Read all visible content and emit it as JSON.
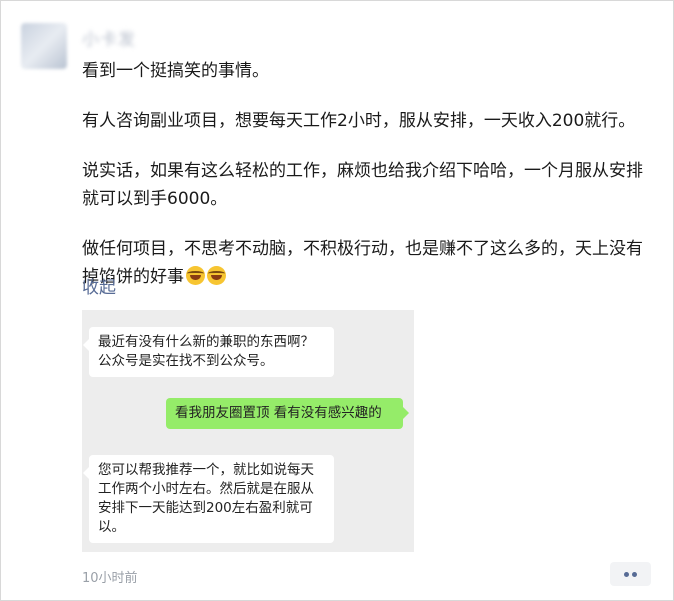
{
  "post": {
    "username": "小卡发",
    "paragraphs": [
      "看到一个挺搞笑的事情。",
      "有人咨询副业项目，想要每天工作2小时，服从安排，一天收入200就行。",
      "说实话，如果有这么轻松的工作，麻烦也给我介绍下哈哈，一个月服从安排就可以到手6000。",
      "做任何项目，不思考不动脑，不积极行动，也是赚不了这么多的，天上没有掉馅饼的好事"
    ],
    "emoji_icons": [
      "laughing-tears-icon",
      "laughing-tears-icon"
    ],
    "collapse_label": "收起",
    "timestamp": "10小时前"
  },
  "chat_screenshot": {
    "messages": [
      {
        "side": "left",
        "text": "最近有没有什么新的兼职的东西啊？公众号是实在找不到公众号。"
      },
      {
        "side": "right",
        "text": "看我朋友圈置顶 看有没有感兴趣的"
      },
      {
        "side": "left",
        "text": "您可以帮我推荐一个，就比如说每天工作两个小时左右。然后就是在服从安排下一天能达到200左右盈利就可以。"
      }
    ]
  },
  "colors": {
    "link": "#576b95",
    "self_bubble": "#95ec69",
    "other_bubble": "#ffffff",
    "chat_background": "#ededed"
  }
}
